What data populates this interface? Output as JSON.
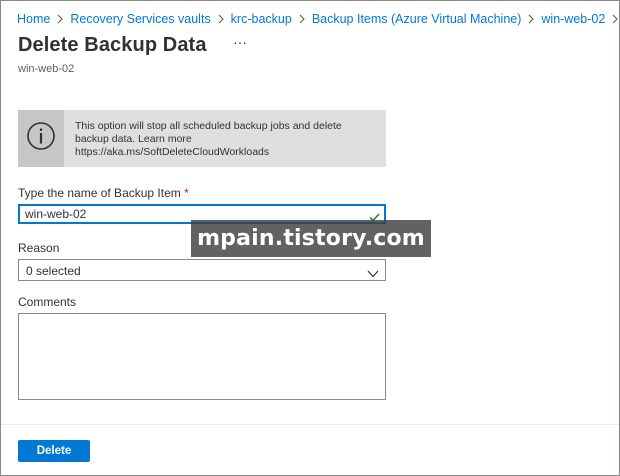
{
  "breadcrumb": [
    {
      "label": "Home"
    },
    {
      "label": "Recovery Services vaults"
    },
    {
      "label": "krc-backup"
    },
    {
      "label": "Backup Items (Azure Virtual Machine)"
    },
    {
      "label": "win-web-02"
    }
  ],
  "header": {
    "title": "Delete Backup Data",
    "more_label": "···",
    "subtitle": "win-web-02"
  },
  "info": {
    "icon": "info-icon",
    "text": "This option will stop all scheduled backup jobs and delete backup data. Learn more https://aka.ms/SoftDeleteCloudWorkloads"
  },
  "form": {
    "backup_item_label": "Type the name of Backup Item",
    "required_marker": "*",
    "backup_item_value": "win-web-02",
    "reason_label": "Reason",
    "reason_value": "0 selected",
    "comments_label": "Comments",
    "comments_value": ""
  },
  "footer": {
    "delete_label": "Delete"
  },
  "watermark": {
    "text": "mpain.tistory.com"
  },
  "colors": {
    "accent": "#0078d4",
    "valid": "#107c10",
    "info_bg": "#e1dfdd",
    "required": "#a4262c"
  }
}
